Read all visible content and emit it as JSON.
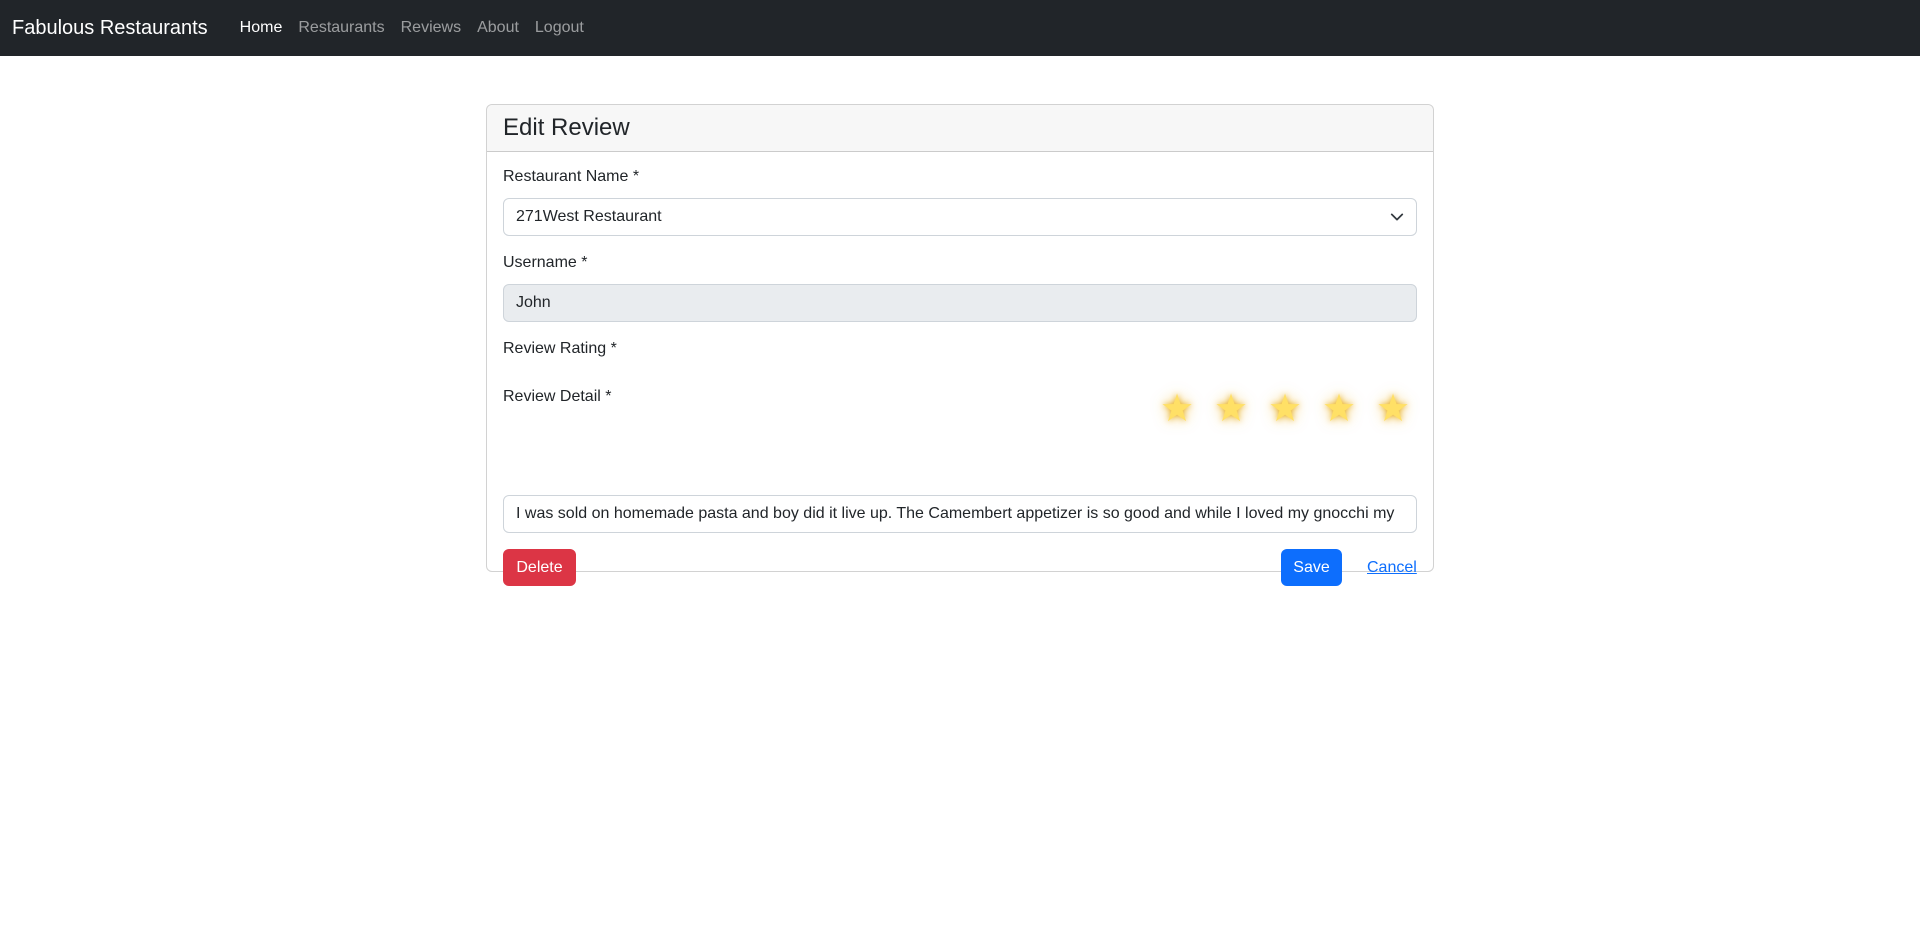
{
  "navbar": {
    "brand": "Fabulous Restaurants",
    "links": [
      {
        "label": "Home",
        "active": true
      },
      {
        "label": "Restaurants",
        "active": false
      },
      {
        "label": "Reviews",
        "active": false
      },
      {
        "label": "About",
        "active": false
      },
      {
        "label": "Logout",
        "active": false
      }
    ]
  },
  "card": {
    "title": "Edit Review"
  },
  "form": {
    "restaurant": {
      "label": "Restaurant Name *",
      "selected": "271West Restaurant"
    },
    "username": {
      "label": "Username *",
      "value": "John"
    },
    "rating": {
      "label": "Review Rating *",
      "value": 5,
      "max": 5,
      "icon": "star-icon",
      "color": "#ffe066"
    },
    "detail": {
      "label": "Review Detail *",
      "value": "I was sold on homemade pasta and boy did it live up. The Camembert appetizer is so good and while I loved my gnocchi my"
    }
  },
  "actions": {
    "delete_label": "Delete",
    "save_label": "Save",
    "cancel_label": "Cancel"
  },
  "colors": {
    "navbar": "#212529",
    "danger": "#dc3545",
    "primary": "#0d6efd"
  }
}
